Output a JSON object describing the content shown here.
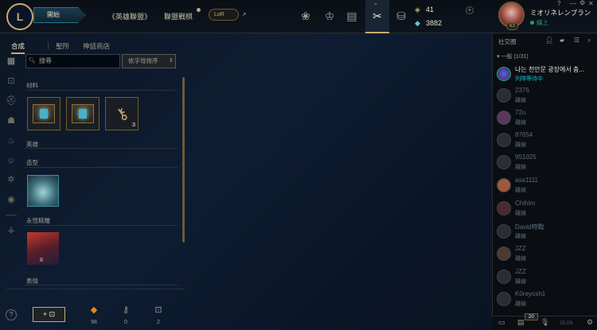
{
  "topbar": {
    "logo": "L",
    "play_label": "開始",
    "nav": [
      "《英雄聯盟》",
      "聯盟戰棋"
    ],
    "lor_label": "LoR",
    "external_arrow": "↗",
    "icons": [
      "home-icon",
      "trophy-icon",
      "collection-icon",
      "loot-icon",
      "store-icon"
    ]
  },
  "currency": {
    "rp": "41",
    "be": "3882"
  },
  "profile": {
    "level": "63",
    "name": "ミオリネレンブラン",
    "status": "線上"
  },
  "window_controls": [
    "?",
    "—",
    "⚙",
    "✕"
  ],
  "tabs": [
    "合成",
    "聖所",
    "神話商店"
  ],
  "search": {
    "placeholder": "搜尋"
  },
  "sort": {
    "value": "依字母排序",
    "arrow": "⇕"
  },
  "sections": [
    "材料",
    "英雄",
    "造型",
    "永恆精雕",
    "表情"
  ],
  "materials": [
    {
      "type": "chest"
    },
    {
      "type": "chest"
    },
    {
      "type": "key",
      "count": "3"
    }
  ],
  "icon_badge": "II",
  "bottom": {
    "add_label": "+",
    "counts": [
      "98",
      "0",
      "2"
    ]
  },
  "social": {
    "title": "社交圈",
    "group_header": "一般 (1/31)",
    "friends": [
      {
        "name": "나는 천안문 광장에서 춤...",
        "status": "列隊等待中",
        "online": true
      },
      {
        "name": "2376",
        "status": "離線"
      },
      {
        "name": "72u",
        "status": "離線"
      },
      {
        "name": "87654",
        "status": "離線"
      },
      {
        "name": "951025",
        "status": "離線"
      },
      {
        "name": "asa1111",
        "status": "離線"
      },
      {
        "name": "Chihiro",
        "status": "離線"
      },
      {
        "name": "David特戰",
        "status": "離線"
      },
      {
        "name": "JZZ",
        "status": "離線"
      },
      {
        "name": "JZZ",
        "status": "離線"
      },
      {
        "name": "K0reyosh1",
        "status": "離線"
      }
    ],
    "chat_count": "20",
    "version": "25.09"
  }
}
